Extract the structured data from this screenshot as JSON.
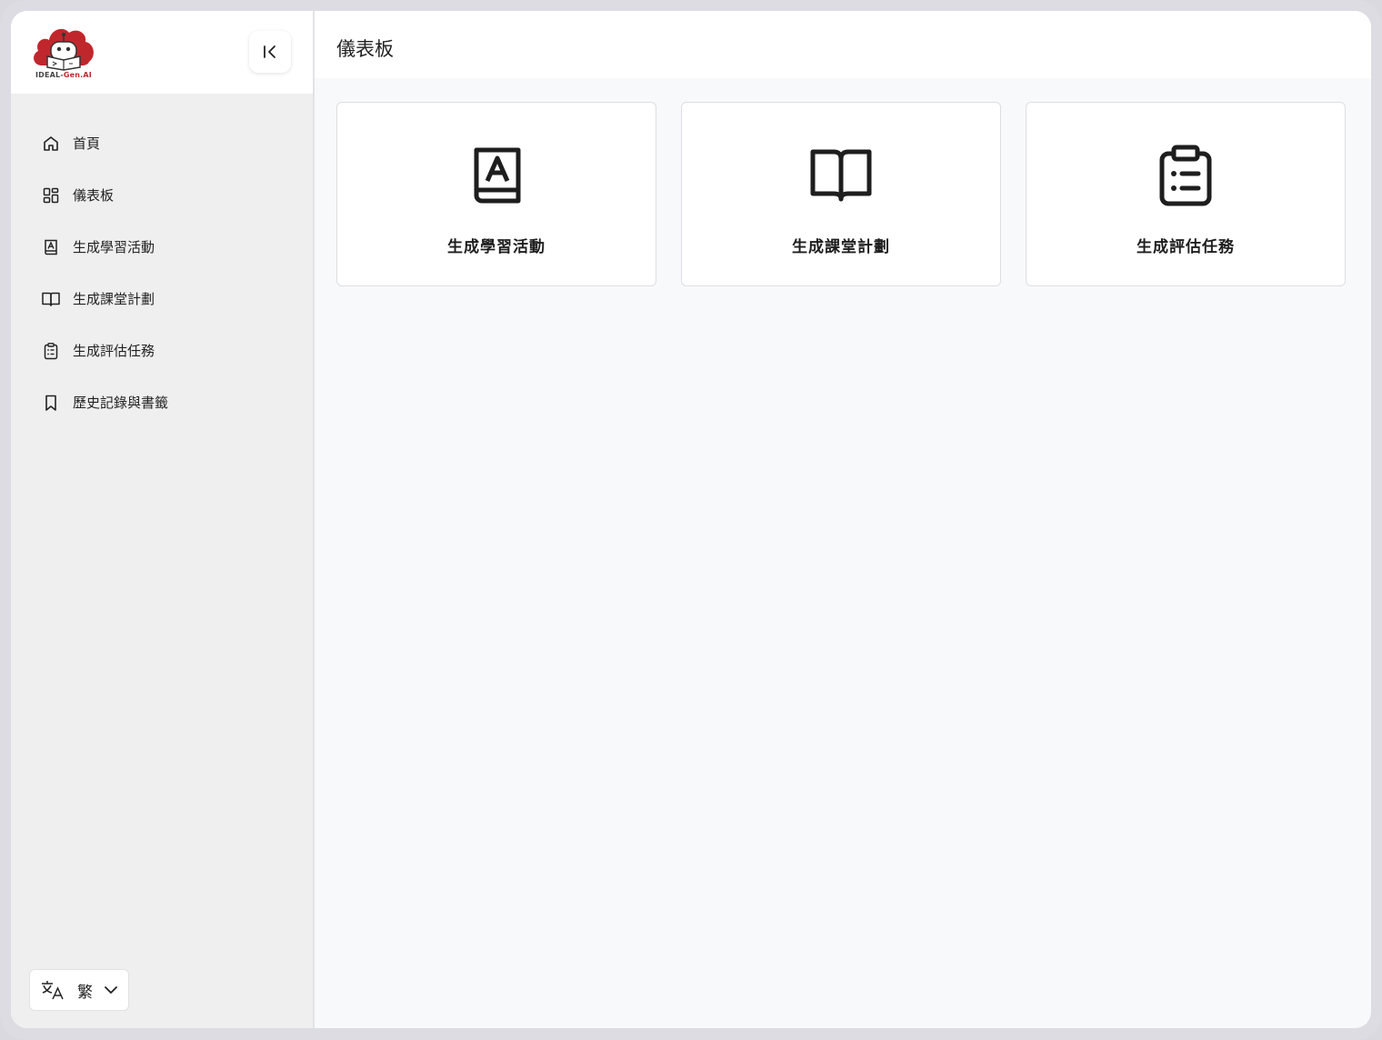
{
  "logo": {
    "text_main": "IDEAL-",
    "text_accent": "Gen.AI",
    "accent_color": "#c0272d"
  },
  "sidebar": {
    "collapse_icon": "collapse-left-icon",
    "items": [
      {
        "label": "首頁",
        "icon": "home-icon"
      },
      {
        "label": "儀表板",
        "icon": "dashboard-icon"
      },
      {
        "label": "生成學習活動",
        "icon": "letter-book-icon"
      },
      {
        "label": "生成課堂計劃",
        "icon": "open-book-icon"
      },
      {
        "label": "生成評估任務",
        "icon": "clipboard-list-icon"
      },
      {
        "label": "歷史記錄與書籤",
        "icon": "bookmark-icon"
      }
    ],
    "language": {
      "value": "繁",
      "icon": "translate-icon"
    }
  },
  "main": {
    "title": "儀表板",
    "cards": [
      {
        "label": "生成學習活動",
        "icon": "letter-book-icon"
      },
      {
        "label": "生成課堂計劃",
        "icon": "open-book-icon"
      },
      {
        "label": "生成評估任務",
        "icon": "clipboard-list-icon"
      }
    ]
  }
}
